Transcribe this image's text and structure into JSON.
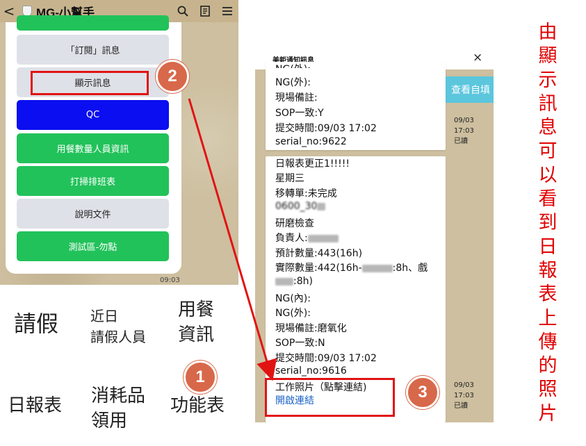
{
  "left_phone": {
    "back_label": "<",
    "title": "MG-小幫手",
    "menu_items": [
      {
        "label": "「訂閱」訊息"
      },
      {
        "label": "顯示訊息"
      },
      {
        "label": "QC"
      },
      {
        "label": "用餐數量人員資訊"
      },
      {
        "label": "打掃排班表"
      },
      {
        "label": "說明文件"
      },
      {
        "label": "測試區-勿點"
      }
    ],
    "time": "09:03"
  },
  "rich_menu": {
    "leave": "請假",
    "recent_leave_line1": "近日",
    "recent_leave_line2": "請假人員",
    "meal_line1": "用餐",
    "meal_line2": "資訊",
    "daily_report": "日報表",
    "consumables_line1": "消耗品",
    "consumables_line2": "領用",
    "function_table": "功能表"
  },
  "badges": {
    "one": "1",
    "two": "2",
    "three": "3"
  },
  "notify": {
    "title": "美鉅通知訊息",
    "close": "×",
    "side_button": "查看自填",
    "bubble1": {
      "lines": [
        "NG(外):",
        "現場備註:",
        "SOP一致:Y",
        "提交時間:09/03 17:02",
        "serial_no:9622"
      ]
    },
    "bubble2": {
      "header": "日報表更正1!!!!!",
      "weekday": "星期三",
      "transfer": "移轉單:未完成",
      "order_prefix": "0600_30",
      "process": "研磨檢查",
      "owner_label": "負責人:",
      "planned": "預計數量:443(16h)",
      "actual_prefix": "實際數量:442(16h-",
      "actual_mid": ":8h、",
      "actual_suffix": ":8h)",
      "ng_in": "NG(內):",
      "ng_out": "NG(外):",
      "remark": "現場備註:磨氧化",
      "sop": "SOP一致:N",
      "submit_time": "提交時間:09/03 17:02",
      "serial": "serial_no:9616",
      "photo_label": "工作照片（點擊連結)",
      "open_link": "開啟連結"
    },
    "meta1": {
      "date": "09/03",
      "time": "17:03",
      "status": "已讀"
    },
    "meta2": {
      "date": "09/03",
      "time": "17:03",
      "status": "已讀"
    }
  },
  "annotation_chars": [
    "由",
    "顯",
    "示",
    "訊",
    "息",
    "可",
    "以",
    "看",
    "到",
    "日",
    "報",
    "表",
    "上",
    "傳",
    "的",
    "照",
    "片"
  ],
  "colors": {
    "accent_red": "#e11313",
    "badge": "#d8684a",
    "green_button": "#22c25a",
    "blue_button": "#0a0ef0",
    "chat_background": "#cdbf9f",
    "link": "#1a62c4"
  }
}
